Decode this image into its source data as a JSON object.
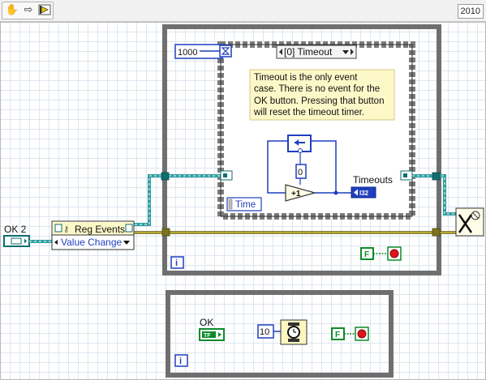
{
  "toolbar": {
    "icons": [
      "hand-icon",
      "arrow-icon",
      "run-icon"
    ],
    "version": "2010"
  },
  "controls": {
    "ok2_label": "OK 2",
    "ok_label": "OK"
  },
  "reg_events": {
    "title": "Reg Events",
    "event": "Value Change"
  },
  "event_structure": {
    "case_label": "[0] Timeout",
    "timeout_ms": "1000",
    "comment": [
      "Timeout is the only event",
      "case. There is no event for the",
      "OK button. Pressing that button",
      "will reset the timeout timer."
    ],
    "time_label": "Time",
    "timeouts_label": "Timeouts",
    "indicator_type": "I32",
    "zero_constant": "0",
    "increment_label": "+1"
  },
  "while_loops": {
    "iteration_label": "i",
    "stop_constant": "F"
  },
  "second_loop": {
    "wait_ms": "10",
    "tf_label": "TF"
  },
  "colors": {
    "loop_border": "#6f6f6f",
    "event_border": "#7b7b7b",
    "numeric_blue": "#1f3fbf",
    "boolean_green": "#0e8a2a",
    "refnum_teal": "#0f6e70",
    "error_yellow": "#bfae1e",
    "comment_bg": "#fdf8c8"
  }
}
